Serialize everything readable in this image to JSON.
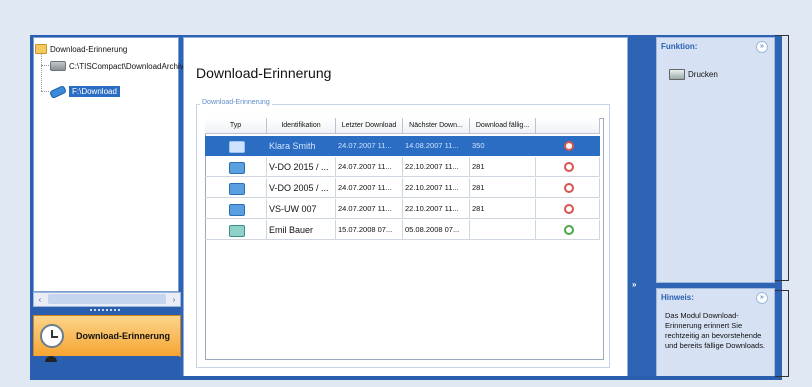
{
  "tree": {
    "root": "Download-Erinnerung",
    "items": [
      {
        "label": "C:\\TISCompact\\DownloadArchiv",
        "icon": "drive-icon"
      },
      {
        "label": "F:\\Download",
        "icon": "usb-stick-icon",
        "selected": true
      }
    ]
  },
  "nav": {
    "active_label": "Download-Erinnerung"
  },
  "main": {
    "title": "Download-Erinnerung",
    "group_label": "Download-Erinnerung",
    "columns": [
      "Typ",
      "Identifikation",
      "Letzter Download",
      "Nächster Down...",
      "Download fällig...",
      ""
    ],
    "rows": [
      {
        "type_icon": "card-icon",
        "id": "Klara Smith",
        "last": "24.07.2007 11...",
        "next": "14.08.2007 11...",
        "due": "350",
        "alarm": "red",
        "selected": true
      },
      {
        "type_icon": "tacho-icon",
        "id": "V-DO 2015 / ...",
        "last": "24.07.2007 11...",
        "next": "22.10.2007 11...",
        "due": "281",
        "alarm": "red"
      },
      {
        "type_icon": "tacho-icon",
        "id": "V-DO 2005 / ...",
        "last": "24.07.2007 11...",
        "next": "22.10.2007 11...",
        "due": "281",
        "alarm": "red"
      },
      {
        "type_icon": "tacho-icon",
        "id": "VS-UW 007",
        "last": "24.07.2007 11...",
        "next": "22.10.2007 11...",
        "due": "281",
        "alarm": "red"
      },
      {
        "type_icon": "driver-card-icon",
        "id": "Emil Bauer",
        "last": "15.07.2008 07...",
        "next": "05.08.2008 07...",
        "due": "",
        "alarm": "green"
      }
    ]
  },
  "side": {
    "function_title": "Funktion:",
    "print_label": "Drucken",
    "hint_title": "Hinweis:",
    "hint_text": "Das Modul Download-Erinnerung erinnert Sie rechtzeitig an bevorstehende und bereits fällige Downloads.",
    "collapse_glyph": "»",
    "expander_glyph": "»"
  },
  "colors": {
    "accent": "#2c6dc4",
    "nav_active": "#f6a531",
    "alarm_red": "#d9534f",
    "alarm_green": "#4aa845"
  }
}
